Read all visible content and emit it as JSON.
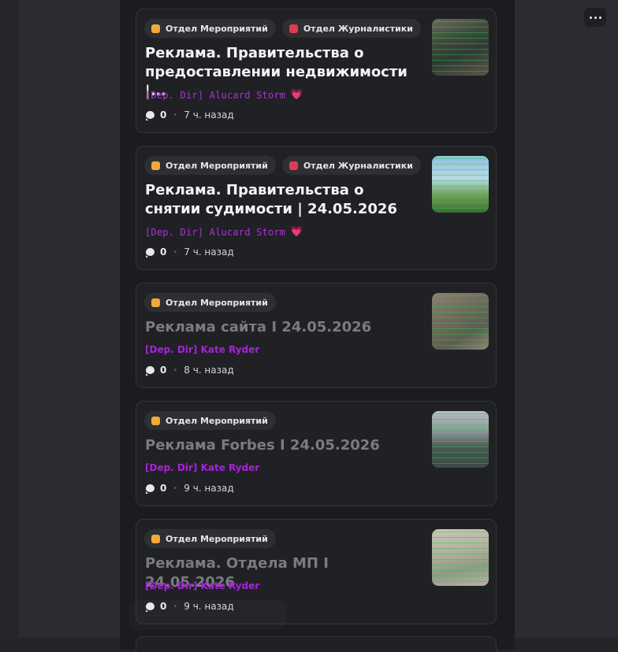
{
  "toolbar": {
    "more_icon": "ellipsis-horizontal-icon"
  },
  "tags": {
    "events": {
      "label": "Отдел Мероприятий",
      "color": "#f2a93b"
    },
    "journalism": {
      "label": "Отдел Журналистики",
      "color": "#e23a55"
    }
  },
  "posts": [
    {
      "title": "Реклама. Правительства о предоставлении недвижимости |...",
      "author": "[Dep. Dir] Alucard Storm",
      "author_emoji": "💗",
      "comments": "0",
      "time": "7 ч. назад"
    },
    {
      "title": "Реклама. Правительства о снятии судимости | 24.05.2026",
      "author": "[Dep. Dir] Alucard Storm",
      "author_emoji": "💗",
      "comments": "0",
      "time": "7 ч. назад"
    },
    {
      "title": "Реклама сайта I 24.05.2026",
      "author": "[Dep. Dir] Kate Ryder",
      "comments": "0",
      "time": "8 ч. назад"
    },
    {
      "title": "Реклама Forbes I 24.05.2026",
      "author": "[Dep. Dir] Kate Ryder",
      "comments": "0",
      "time": "9 ч. назад"
    },
    {
      "title": "Реклама. Отдела МП I 24.05.2026",
      "author": "[Dep. Dir] Kate Ryder",
      "comments": "0",
      "time": "9 ч. назад"
    }
  ]
}
